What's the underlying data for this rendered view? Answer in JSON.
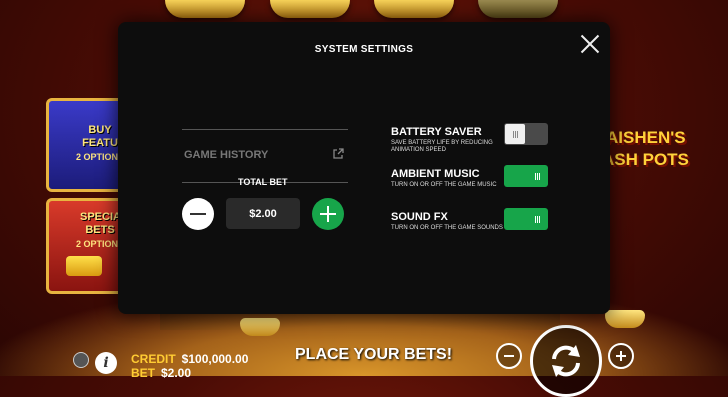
{
  "game": {
    "logo_line1": "AISHEN'S",
    "logo_line2": "ASH POTS",
    "buy_feature_label": "BUY FEATU",
    "buy_feature_sub": "2 OPTION",
    "special_bets_label": "SPECIA BETS",
    "special_bets_sub": "2 OPTION",
    "credit_label": "CREDIT",
    "credit_value": "$100,000.00",
    "bet_label": "BET",
    "bet_value": "$2.00",
    "place_bets_text": "PLACE YOUR BETS!"
  },
  "settings": {
    "title": "SYSTEM SETTINGS",
    "game_history_label": "GAME HISTORY",
    "total_bet_label": "TOTAL BET",
    "total_bet_value": "$2.00",
    "options": [
      {
        "title": "BATTERY SAVER",
        "desc": "SAVE BATTERY LIFE BY REDUCING ANIMATION SPEED",
        "enabled": false
      },
      {
        "title": "AMBIENT MUSIC",
        "desc": "TURN ON OR OFF THE GAME MUSIC",
        "enabled": true
      },
      {
        "title": "SOUND FX",
        "desc": "TURN ON OR OFF THE GAME SOUNDS",
        "enabled": true
      }
    ]
  },
  "colors": {
    "toggle_on": "#17a54a",
    "toggle_off": "#4a4a4a",
    "plus_button": "#17a54a",
    "accent_gold": "#ffcc33"
  },
  "icons": [
    "close-icon",
    "external-link-icon",
    "minus-icon",
    "plus-icon",
    "spin-icon",
    "info-icon",
    "menu-icon"
  ]
}
